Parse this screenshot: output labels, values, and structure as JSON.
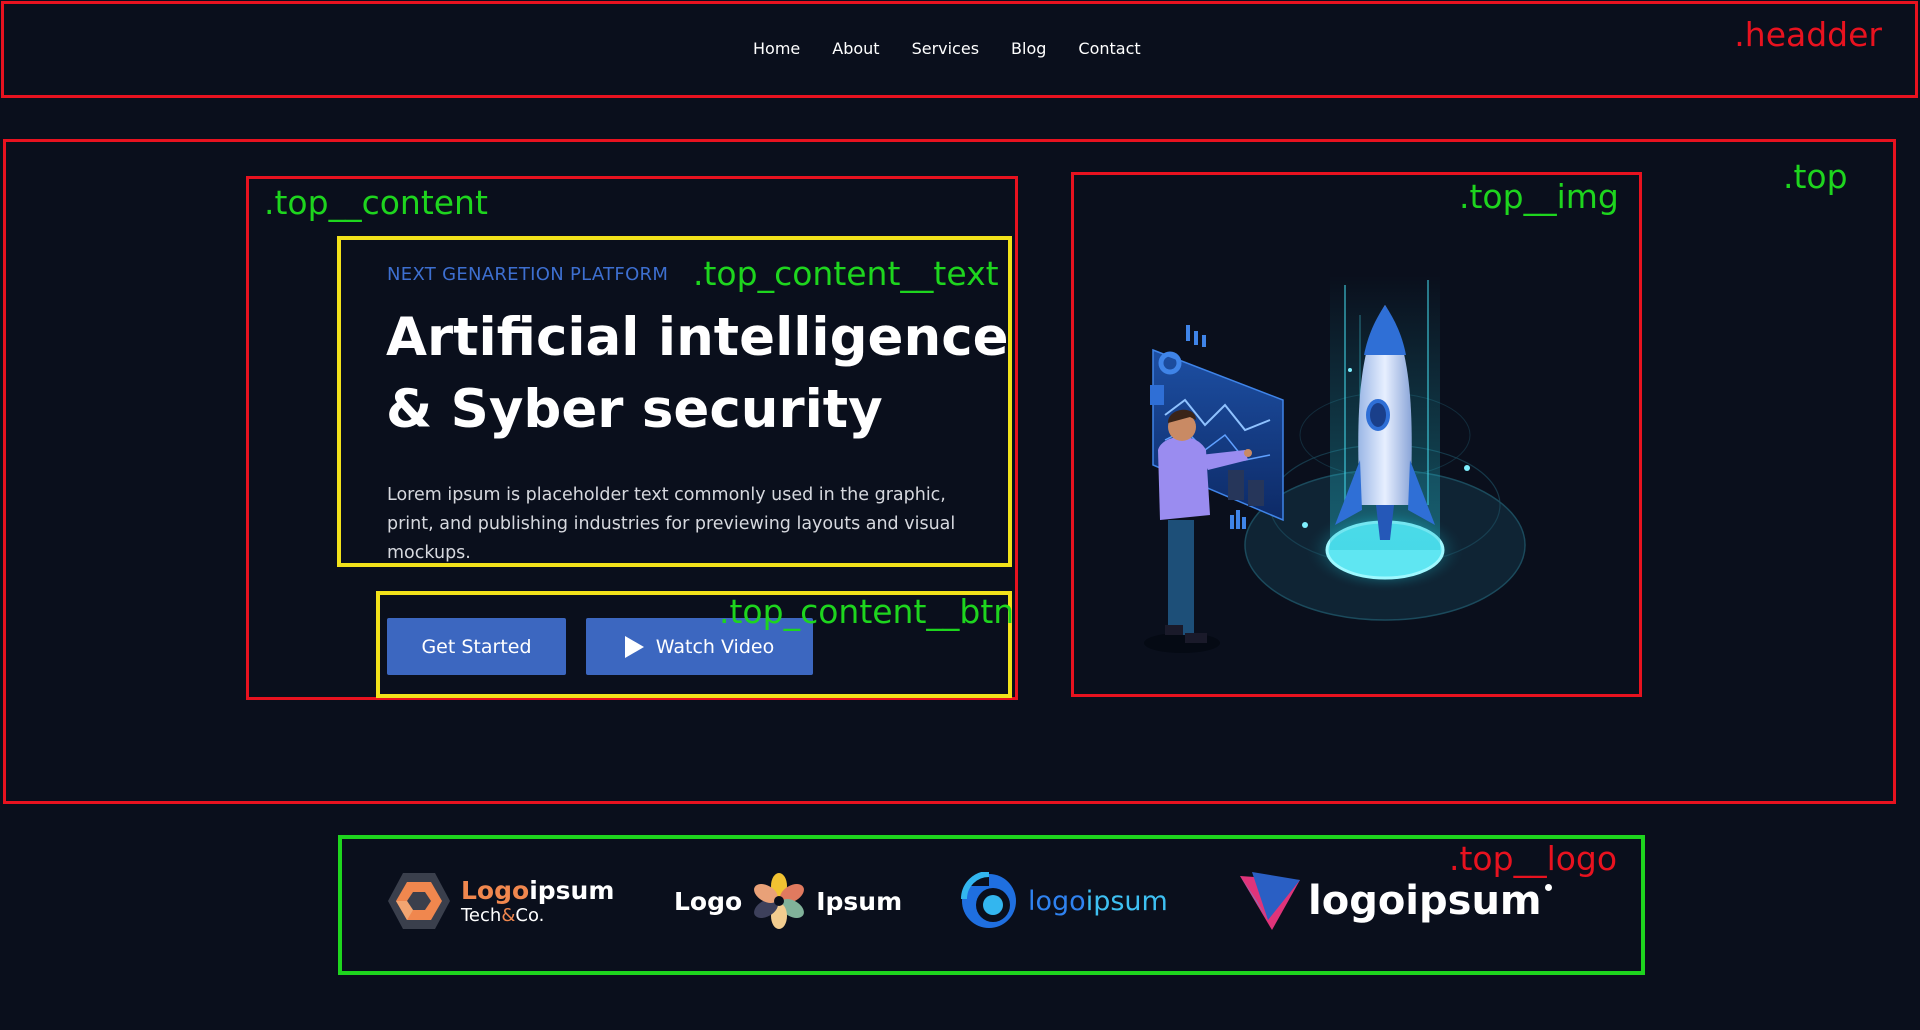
{
  "annotations": {
    "header": ".headder",
    "top": ".top",
    "top_content": ".top__content",
    "top_content_text": ".top_content__text",
    "top_content_btn": ".top_content__btn",
    "top_img": ".top__img",
    "top_logo": ".top__logo"
  },
  "nav": {
    "items": [
      {
        "label": "Home"
      },
      {
        "label": "About"
      },
      {
        "label": "Services"
      },
      {
        "label": "Blog"
      },
      {
        "label": "Contact"
      }
    ]
  },
  "hero": {
    "eyebrow": "NEXT GENARETION PLATFORM",
    "headline_line1": "Artificial intelligence",
    "headline_line2": "& Syber security",
    "description": "Lorem ipsum is placeholder text commonly used in the graphic, print, and publishing industries for previewing layouts and visual mockups.",
    "primary_button": "Get Started",
    "secondary_button": "Watch Video"
  },
  "logos": {
    "logo1": {
      "word_a": "Logo",
      "word_b": "ipsum",
      "tagline_a": "Tech",
      "tagline_amp": "&",
      "tagline_b": "Co."
    },
    "logo2": {
      "left": "Logo",
      "right": "Ipsum"
    },
    "logo3": {
      "word_a": "logo",
      "word_b": "ipsum"
    },
    "logo4": {
      "word": "logoipsum"
    }
  },
  "colors": {
    "background": "#0a0f1c",
    "annotation_red": "#e8121f",
    "annotation_green": "#1ed51e",
    "annotation_yellow": "#f2e21a",
    "accent_blue": "#3c67c0",
    "eyebrow_blue": "#3d6fd0"
  },
  "icons": {
    "illustration": "person-with-rocket-dashboard-illustration",
    "play": "play-icon"
  }
}
